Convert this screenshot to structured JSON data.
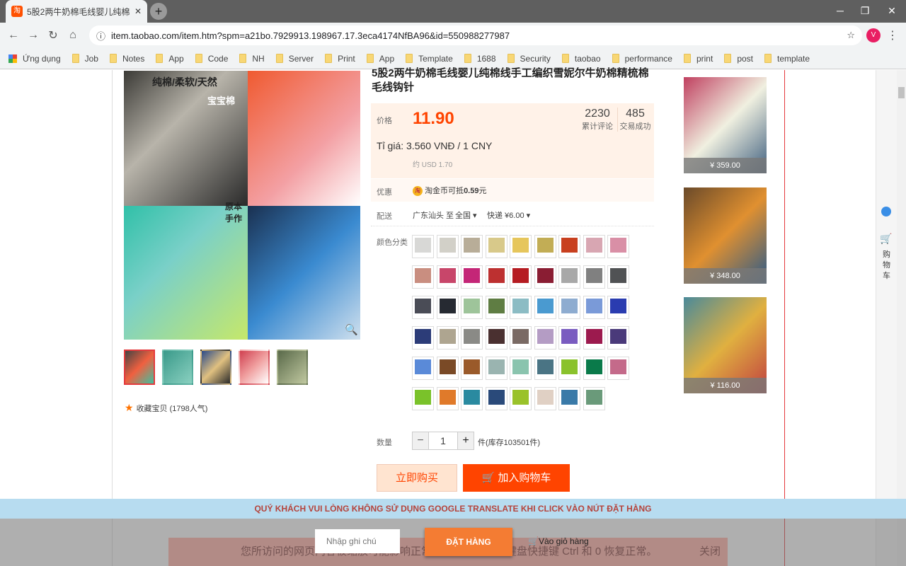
{
  "browser": {
    "tab_title": "5股2两牛奶棉毛线婴儿纯棉线手工",
    "favicon": "淘",
    "url": "item.taobao.com/item.htm?spm=a21bo.7929913.198967.17.3eca4174NfBA96&id=550988277987",
    "avatar": "V",
    "bookmarks": [
      "Ứng dụng",
      "Job",
      "Notes",
      "App",
      "Code",
      "NH",
      "Server",
      "Print",
      "App",
      "Template",
      "1688",
      "Security",
      "taobao",
      "performance",
      "print",
      "post",
      "template"
    ]
  },
  "product": {
    "title": "5股2两牛奶棉毛线婴儿纯棉线手工编织雪妮尔牛奶棉精梳棉毛线钩针",
    "price_label": "价格",
    "price": "11.90",
    "reviews": "2230",
    "reviews_label": "累计评论",
    "sales": "485",
    "sales_label": "交易成功",
    "rate": "Tỉ giá: 3.560 VNĐ / 1 CNY",
    "usd": "约 USD 1.70",
    "promo_label": "优惠",
    "promo_text": "淘金币可抵",
    "promo_value": "0.59",
    "promo_unit": "元",
    "ship_label": "配送",
    "ship_from": "广东汕头 至",
    "ship_to": "全国 ▾",
    "ship_method": "快递 ¥6.00 ▾",
    "color_label": "颜色分类",
    "qty_label": "数量",
    "qty": "1",
    "stock": "件(库存103501件)",
    "buy_now": "立即购买",
    "add_cart": "加入购物车",
    "favorite": "收藏宝贝 (1798人气)",
    "gallery_text": [
      "纯棉/柔软/天然",
      "宝宝棉",
      "原本手作"
    ]
  },
  "swatches": [
    "#d8d8d6",
    "#d2d0c8",
    "#b8ad98",
    "#d8c98a",
    "#e6c65c",
    "#c2ad55",
    "#c8401f",
    "#d8a6b2",
    "#d98fa6",
    "#c98e80",
    "#c8466a",
    "#c42677",
    "#bd3030",
    "#b51c22",
    "#8a1d33",
    "#a8a8a8",
    "#808080",
    "#505254",
    "#4a4c56",
    "#262a32",
    "#9ec49a",
    "#5f7d43",
    "#8cbcc4",
    "#4a9ad0",
    "#8eacd0",
    "#7a9ad8",
    "#2a3cb0",
    "#2c3c78",
    "#aea590",
    "#8a8a86",
    "#4a3030",
    "#7a6a64",
    "#b49cc4",
    "#7a5cc0",
    "#9c1a4e",
    "#4a3a7a",
    "#5a8ad8",
    "#7a4a26",
    "#9a5a2a",
    "#9ab4b0",
    "#8ac4ae",
    "#4a7484",
    "#8ac22c",
    "#0a7a4a",
    "#c46a8a",
    "#7ac22a",
    "#e07a2a",
    "#2a8aa0",
    "#2a4a7a",
    "#9ac22a",
    "#e0d0c4",
    "#3a7aa8",
    "#6a9a7a"
  ],
  "recommend": [
    {
      "price": "¥ 359.00"
    },
    {
      "price": "¥ 348.00"
    },
    {
      "price": "¥ 116.00"
    }
  ],
  "sidebar": {
    "cart_label": "购物车"
  },
  "overlay": {
    "notice": "QUÝ KHÁCH VUI LÒNG KHÔNG SỬ DỤNG GOOGLE TRANSLATE KHI CLICK VÀO NÚT ĐẶT HÀNG",
    "note_placeholder": "Nhập ghi chú",
    "order": "ĐẶT HÀNG",
    "go_cart": "Vào giỏ hàng",
    "zoom_msg": "您所访问的网页内容被缩放可能影响正常使用，可以使用键盘快捷键 Ctrl 和 0 恢复正常。",
    "zoom_close": "关闭"
  },
  "colors": {
    "accent": "#ff4400",
    "notice_bg": "#b7dcf0",
    "order_btn": "#f47c33"
  }
}
